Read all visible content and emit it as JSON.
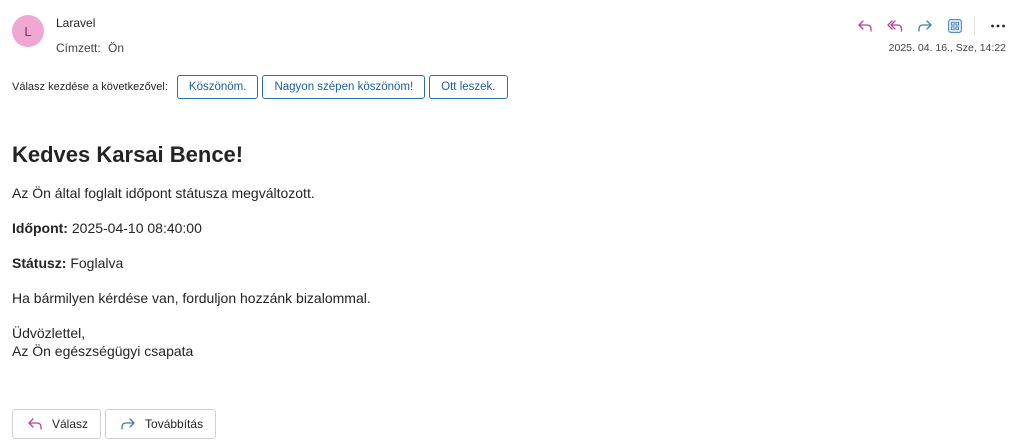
{
  "header": {
    "avatar_initial": "L",
    "sender": "Laravel",
    "recipient_label": "Címzett:",
    "recipient": "Ön",
    "datetime": "2025. 04. 16., Sze, 14:22"
  },
  "toolbar": {
    "icons": [
      "reply-icon",
      "reply-all-icon",
      "forward-icon",
      "apps-icon",
      "more-icon"
    ],
    "more_glyph": "···"
  },
  "suggested_replies": {
    "label": "Válasz kezdése a következővel:",
    "options": [
      "Köszönöm.",
      "Nagyon szépen köszönöm!",
      "Ott leszek."
    ]
  },
  "message": {
    "greeting": "Kedves Karsai Bence!",
    "line1": "Az Ön által foglalt időpont státusza megváltozott.",
    "appointment_label": "Időpont:",
    "appointment_value": "2025-04-10 08:40:00",
    "status_label": "Státusz:",
    "status_value": "Foglalva",
    "line2": "Ha bármilyen kérdése van, forduljon hozzánk bizalommal.",
    "closing": "Üdvözlettel,",
    "signature": "Az Ön egészségügyi csapata"
  },
  "actions": {
    "reply_label": "Válasz",
    "forward_label": "Továbbítás"
  },
  "colors": {
    "accent_reply": "#b4449b",
    "accent_forward": "#3a7fb8",
    "chip_border": "#2b6fa8",
    "avatar_bg": "#f0a8d2"
  }
}
